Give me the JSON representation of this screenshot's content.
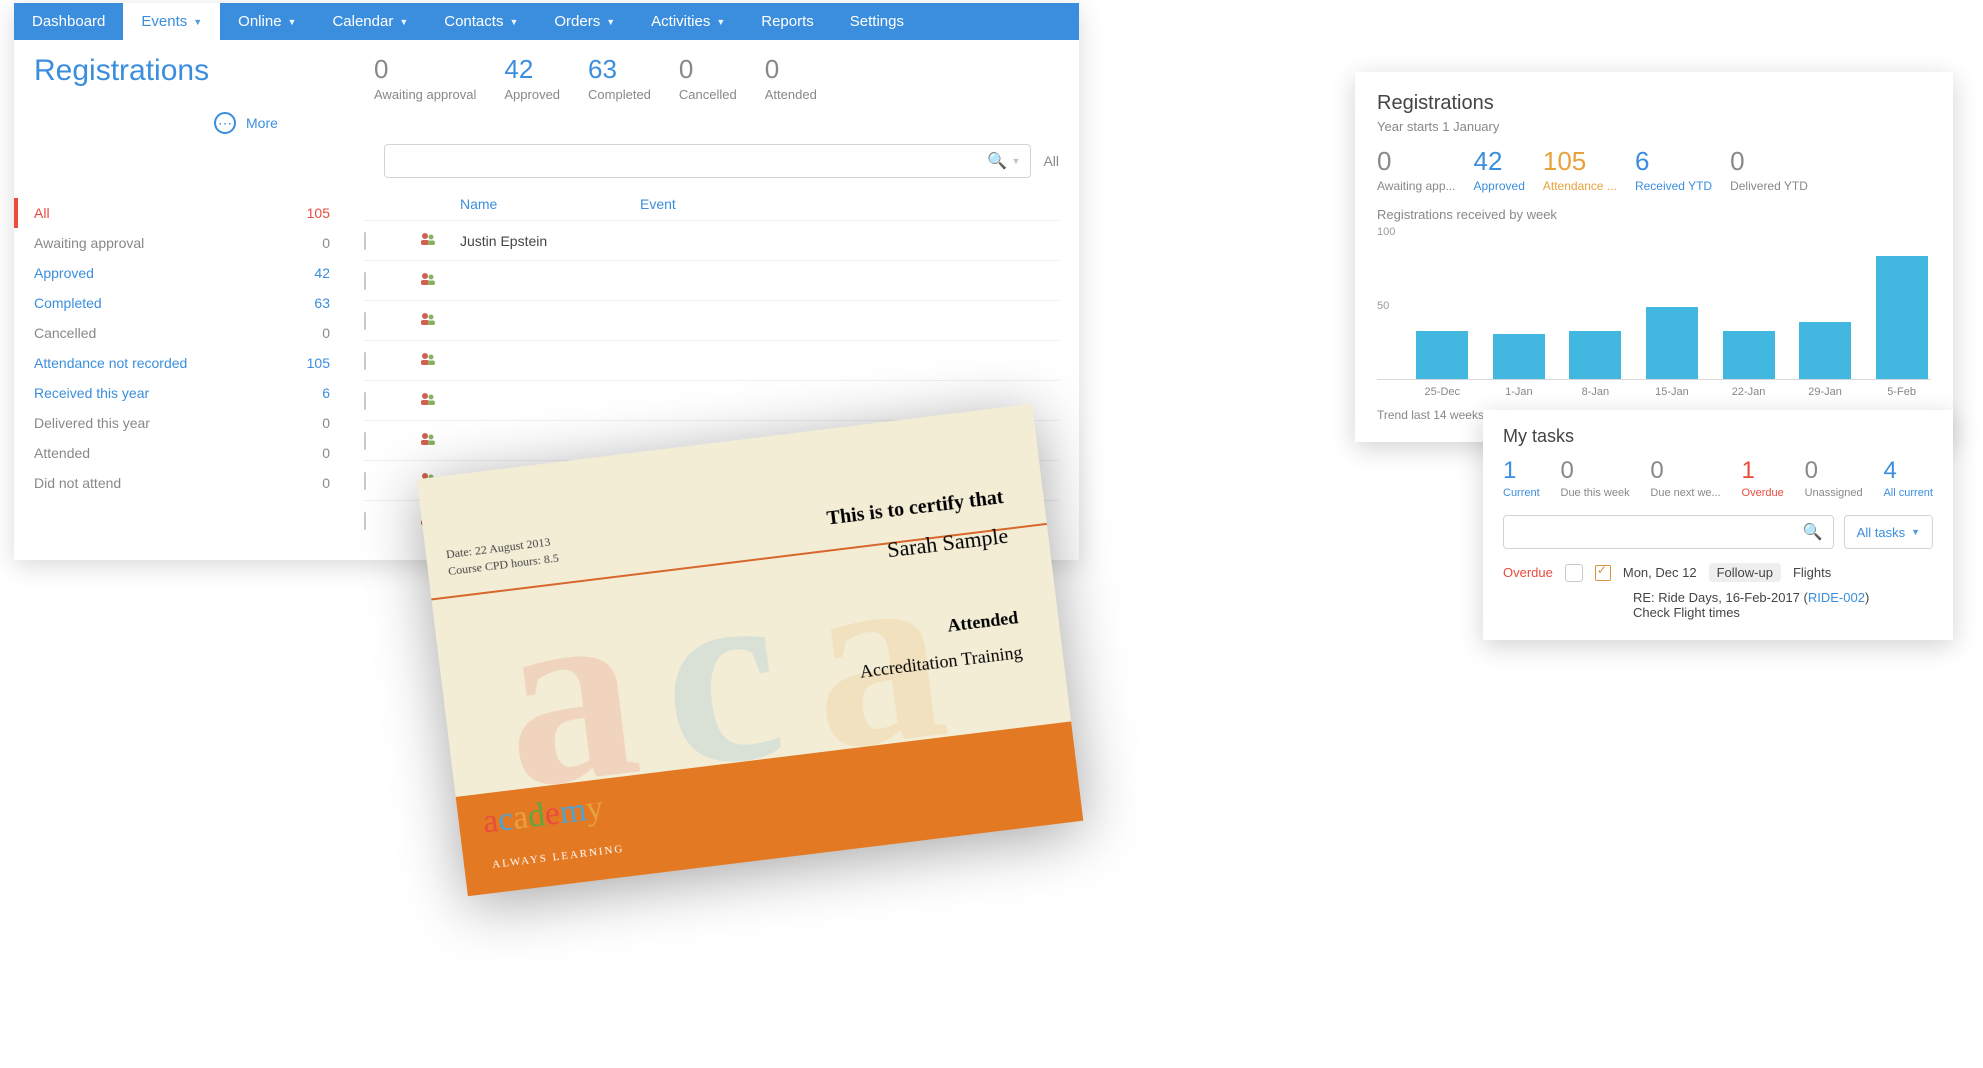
{
  "nav": {
    "items": [
      {
        "label": "Dashboard",
        "caret": false
      },
      {
        "label": "Events",
        "caret": true,
        "active": true
      },
      {
        "label": "Online",
        "caret": true
      },
      {
        "label": "Calendar",
        "caret": true
      },
      {
        "label": "Contacts",
        "caret": true
      },
      {
        "label": "Orders",
        "caret": true
      },
      {
        "label": "Activities",
        "caret": true
      },
      {
        "label": "Reports",
        "caret": false
      },
      {
        "label": "Settings",
        "caret": false
      }
    ]
  },
  "registrations": {
    "title": "Registrations",
    "more": "More",
    "stats": [
      {
        "num": "0",
        "label": "Awaiting approval",
        "blue": false
      },
      {
        "num": "42",
        "label": "Approved",
        "blue": true
      },
      {
        "num": "63",
        "label": "Completed",
        "blue": true
      },
      {
        "num": "0",
        "label": "Cancelled",
        "blue": false
      },
      {
        "num": "0",
        "label": "Attended",
        "blue": false
      }
    ],
    "all_label": "All",
    "filters": [
      {
        "label": "All",
        "count": "105",
        "cls": "all"
      },
      {
        "label": "Awaiting approval",
        "count": "0",
        "cls": "gray"
      },
      {
        "label": "Approved",
        "count": "42",
        "cls": "blue"
      },
      {
        "label": "Completed",
        "count": "63",
        "cls": "blue"
      },
      {
        "label": "Cancelled",
        "count": "0",
        "cls": "gray"
      },
      {
        "label": "Attendance not recorded",
        "count": "105",
        "cls": "blue"
      },
      {
        "label": "Received this year",
        "count": "6",
        "cls": "blue"
      },
      {
        "label": "Delivered this year",
        "count": "0",
        "cls": "gray"
      },
      {
        "label": "Attended",
        "count": "0",
        "cls": "gray"
      },
      {
        "label": "Did not attend",
        "count": "0",
        "cls": "gray"
      }
    ],
    "columns": {
      "name": "Name",
      "event": "Event"
    },
    "rows": [
      {
        "name": "Justin Epstein"
      }
    ]
  },
  "certificate": {
    "meta_date": "Date: 22 August 2013",
    "meta_cpd": "Course CPD hours: 8.5",
    "title": "This is to certify that",
    "name": "Sarah Sample",
    "attended": "Attended",
    "course": "Accreditation Training",
    "logo": "academy",
    "tag": "ALWAYS LEARNING"
  },
  "dashboard": {
    "title": "Registrations",
    "subtitle": "Year starts 1 January",
    "stats": [
      {
        "num": "0",
        "label": "Awaiting app...",
        "color": "gray"
      },
      {
        "num": "42",
        "label": "Approved",
        "color": "blue"
      },
      {
        "num": "105",
        "label": "Attendance ...",
        "color": "orange"
      },
      {
        "num": "6",
        "label": "Received YTD",
        "color": "blue"
      },
      {
        "num": "0",
        "label": "Delivered YTD",
        "color": "gray"
      }
    ],
    "chart_title": "Registrations received by week",
    "trend": "Trend last 14 weeks"
  },
  "chart_data": {
    "type": "bar",
    "categories": [
      "25-Dec",
      "1-Jan",
      "8-Jan",
      "15-Jan",
      "22-Jan",
      "29-Jan",
      "5-Feb"
    ],
    "values": [
      32,
      30,
      32,
      48,
      32,
      38,
      82
    ],
    "title": "Registrations received by week",
    "xlabel": "",
    "ylabel": "",
    "ylim": [
      0,
      100
    ],
    "yticks": [
      50,
      100
    ]
  },
  "tasks": {
    "title": "My tasks",
    "stats": [
      {
        "num": "1",
        "label": "Current",
        "color": "blue"
      },
      {
        "num": "0",
        "label": "Due this week",
        "color": "gray"
      },
      {
        "num": "0",
        "label": "Due next we...",
        "color": "gray"
      },
      {
        "num": "1",
        "label": "Overdue",
        "color": "red"
      },
      {
        "num": "0",
        "label": "Unassigned",
        "color": "gray"
      },
      {
        "num": "4",
        "label": "All current",
        "color": "blue"
      }
    ],
    "dropdown": "All tasks",
    "row": {
      "status": "Overdue",
      "date": "Mon, Dec 12",
      "badge": "Follow-up",
      "subject": "Flights",
      "re_prefix": "RE: Ride Days, 16-Feb-2017 (",
      "re_link": "RIDE-002",
      "re_suffix": ")",
      "note": "Check Flight times"
    }
  }
}
